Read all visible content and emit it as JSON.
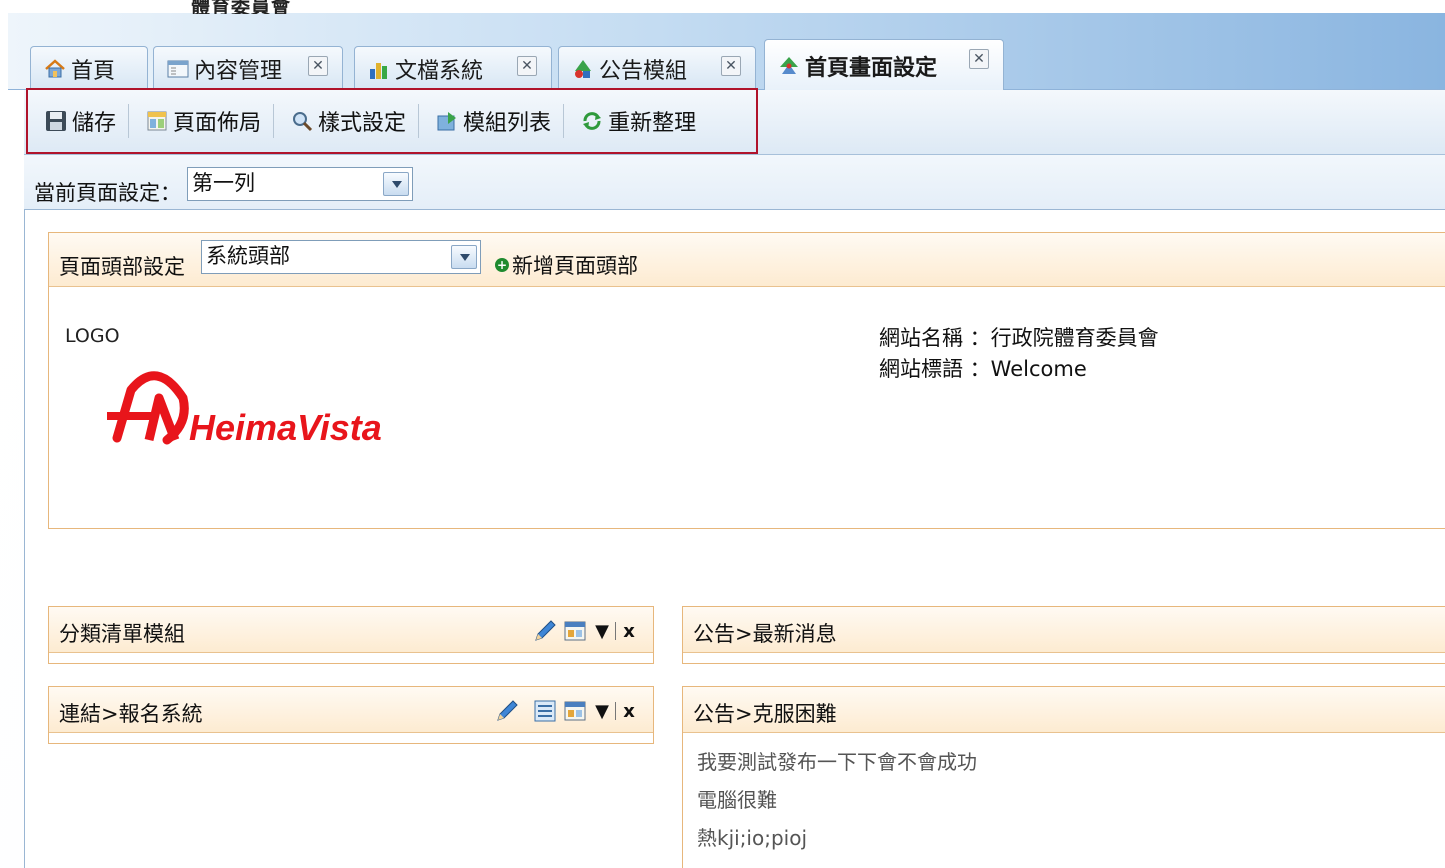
{
  "app": {
    "title_fragment": "體育委員會"
  },
  "tabs": [
    {
      "label": "首頁",
      "icon": "home-icon",
      "closable": false
    },
    {
      "label": "內容管理",
      "icon": "content-window-icon",
      "closable": true
    },
    {
      "label": "文檔系統",
      "icon": "bar-chart-icon",
      "closable": true
    },
    {
      "label": "公告模組",
      "icon": "announcement-icon",
      "closable": true
    },
    {
      "label": "首頁畫面設定",
      "icon": "homepage-setting-icon",
      "closable": true,
      "active": true
    }
  ],
  "toolbar": {
    "save": "儲存",
    "layout": "頁面佈局",
    "style": "樣式設定",
    "modules": "模組列表",
    "refresh": "重新整理"
  },
  "current_page": {
    "label": "當前頁面設定：",
    "value": "第一列"
  },
  "header_panel": {
    "label": "頁面頭部設定",
    "select_value": "系統頭部",
    "add_label": "新增頁面頭部",
    "logo_label": "LOGO",
    "logo_text": "HeimaVista",
    "site_name_line": "網站名稱 ：行政院體育委員會",
    "site_slogan_line": "網站標語 ：Welcome"
  },
  "modules": {
    "left": [
      {
        "title": "分類清單模組"
      },
      {
        "title": "連結>報名系統"
      }
    ],
    "right": [
      {
        "title": "公告>最新消息",
        "items": []
      },
      {
        "title": "公告>克服困難",
        "items": [
          "我要測試發布一下下會不會成功",
          "電腦很難",
          "熱kji;io;pioj"
        ]
      }
    ],
    "sort_glyph": "▼",
    "close_glyph": "x"
  },
  "colors": {
    "toolbar_highlight": "#b0132b",
    "panel_border": "#e7b77c",
    "panel_header_bg": "#fdebd1",
    "logo_red": "#e8151b"
  }
}
